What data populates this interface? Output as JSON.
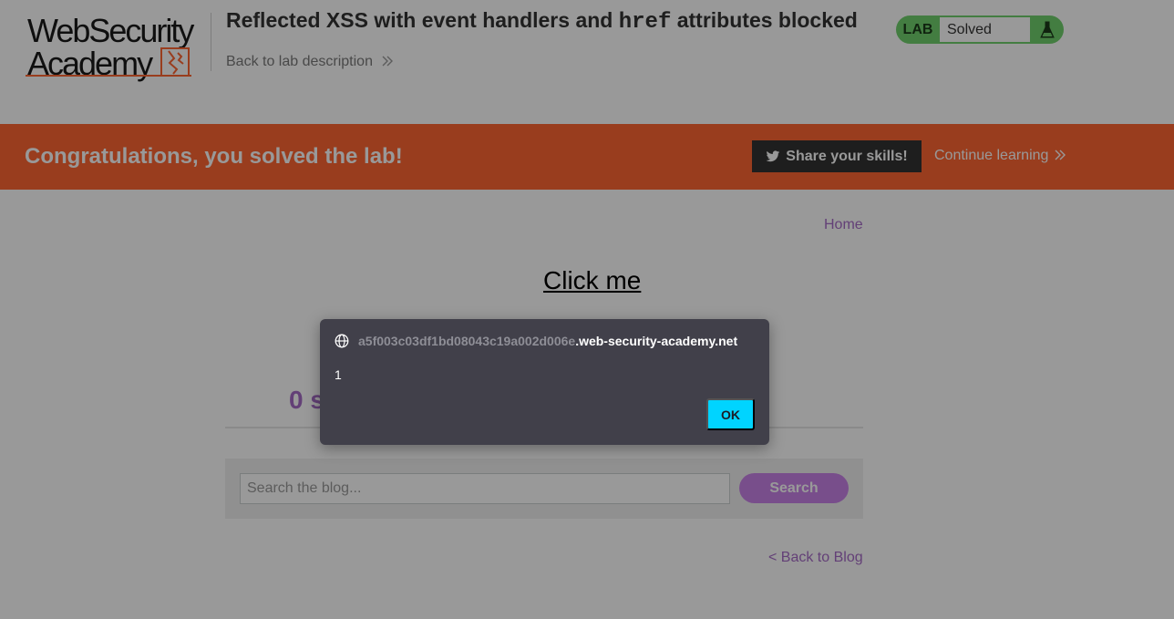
{
  "header": {
    "logo_line1": "WebSecurity",
    "logo_line2": "Academy",
    "title_part1": "Reflected XSS with event handlers and ",
    "title_code": "href",
    "title_part2": " attributes blocked",
    "back_label": "Back to lab description",
    "status_badge": "LAB",
    "status_text": "Solved"
  },
  "banner": {
    "message": "Congratulations, you solved the lab!",
    "share_label": "Share your skills!",
    "continue_label": "Continue learning"
  },
  "main": {
    "home_link": "Home",
    "click_me": "Click me",
    "results_visible": "0 s",
    "search_placeholder": "Search the blog...",
    "search_button": "Search",
    "back_to_blog": "< Back to Blog"
  },
  "dialog": {
    "origin_prefix": "a5f003c03df1bd08043c19a002d006e",
    "origin_domain": ".web-security-academy.net",
    "message": "1",
    "ok_label": "OK"
  },
  "colors": {
    "brand_orange": "#ff6633",
    "solved_green": "#70d16d",
    "link_purple": "#a66bc6",
    "dialog_bg": "#41404a",
    "ok_cyan": "#00d4ff"
  },
  "icons": {
    "lab_status": "flask-icon",
    "share": "twitter-icon",
    "continue": "double-chevron-right-icon",
    "dialog_origin": "globe-icon"
  }
}
